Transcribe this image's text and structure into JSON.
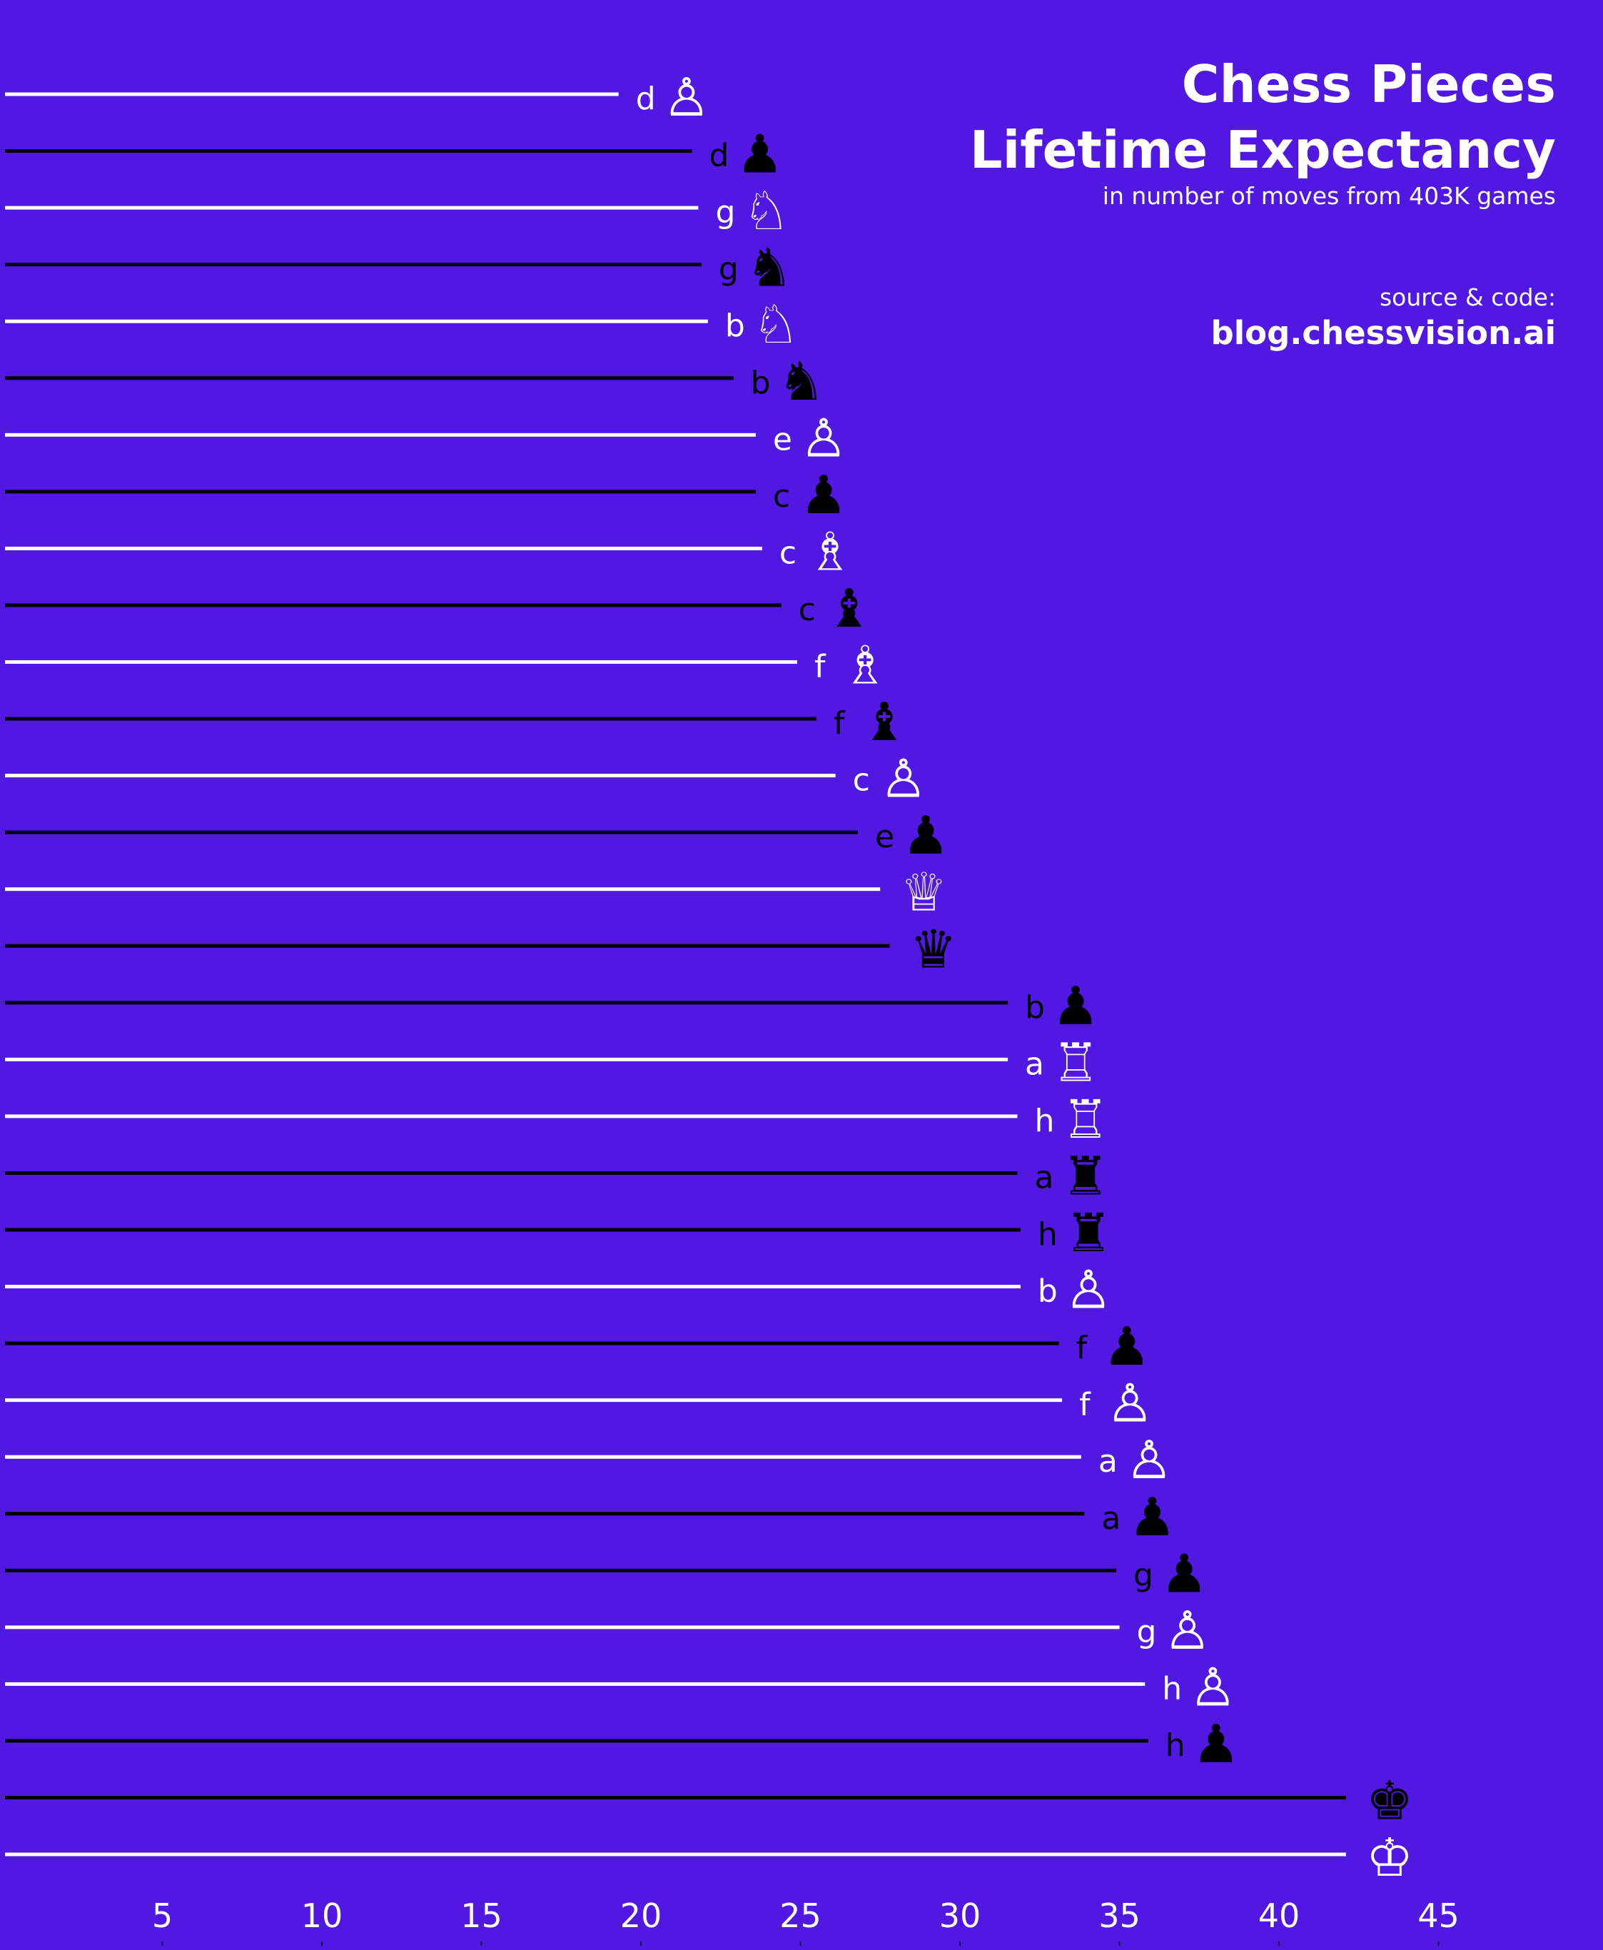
{
  "header": {
    "title_line1": "Chess Pieces",
    "title_line2": "Lifetime Expectancy",
    "subtitle": "in number of moves from 403K games",
    "source_label": "source & code:",
    "source_link": "blog.chessvision.ai"
  },
  "colors": {
    "background": "#5018e0",
    "white_piece": "#ffffff",
    "black_piece": "#000000"
  },
  "chart_data": {
    "type": "bar",
    "orientation": "horizontal",
    "title": "Chess Pieces Lifetime Expectancy",
    "subtitle": "in number of moves from 403K games",
    "xlabel": "",
    "ylabel": "",
    "xlim": [
      0,
      47
    ],
    "xticks": [
      5,
      10,
      15,
      20,
      25,
      30,
      35,
      40,
      45
    ],
    "grid": false,
    "legend": "none",
    "bars": [
      {
        "color": "white",
        "piece": "pawn",
        "file": "d",
        "value": 19.3
      },
      {
        "color": "black",
        "piece": "pawn",
        "file": "d",
        "value": 21.6
      },
      {
        "color": "white",
        "piece": "knight",
        "file": "g",
        "value": 21.8
      },
      {
        "color": "black",
        "piece": "knight",
        "file": "g",
        "value": 21.9
      },
      {
        "color": "white",
        "piece": "knight",
        "file": "b",
        "value": 22.1
      },
      {
        "color": "black",
        "piece": "knight",
        "file": "b",
        "value": 22.9
      },
      {
        "color": "white",
        "piece": "pawn",
        "file": "e",
        "value": 23.6
      },
      {
        "color": "black",
        "piece": "pawn",
        "file": "c",
        "value": 23.6
      },
      {
        "color": "white",
        "piece": "bishop",
        "file": "c",
        "value": 23.8
      },
      {
        "color": "black",
        "piece": "bishop",
        "file": "c",
        "value": 24.4
      },
      {
        "color": "white",
        "piece": "bishop",
        "file": "f",
        "value": 24.9
      },
      {
        "color": "black",
        "piece": "bishop",
        "file": "f",
        "value": 25.5
      },
      {
        "color": "white",
        "piece": "pawn",
        "file": "c",
        "value": 26.1
      },
      {
        "color": "black",
        "piece": "pawn",
        "file": "e",
        "value": 26.8
      },
      {
        "color": "white",
        "piece": "queen",
        "file": "",
        "value": 27.5
      },
      {
        "color": "black",
        "piece": "queen",
        "file": "",
        "value": 27.8
      },
      {
        "color": "black",
        "piece": "pawn",
        "file": "b",
        "value": 31.5
      },
      {
        "color": "white",
        "piece": "rook",
        "file": "a",
        "value": 31.5
      },
      {
        "color": "white",
        "piece": "rook",
        "file": "h",
        "value": 31.8
      },
      {
        "color": "black",
        "piece": "rook",
        "file": "a",
        "value": 31.8
      },
      {
        "color": "black",
        "piece": "rook",
        "file": "h",
        "value": 31.9
      },
      {
        "color": "white",
        "piece": "pawn",
        "file": "b",
        "value": 31.9
      },
      {
        "color": "black",
        "piece": "pawn",
        "file": "f",
        "value": 33.1
      },
      {
        "color": "white",
        "piece": "pawn",
        "file": "f",
        "value": 33.2
      },
      {
        "color": "white",
        "piece": "pawn",
        "file": "a",
        "value": 33.8
      },
      {
        "color": "black",
        "piece": "pawn",
        "file": "a",
        "value": 33.9
      },
      {
        "color": "black",
        "piece": "pawn",
        "file": "g",
        "value": 34.9
      },
      {
        "color": "white",
        "piece": "pawn",
        "file": "g",
        "value": 35.0
      },
      {
        "color": "white",
        "piece": "pawn",
        "file": "h",
        "value": 35.8
      },
      {
        "color": "black",
        "piece": "pawn",
        "file": "h",
        "value": 35.9
      },
      {
        "color": "black",
        "piece": "king",
        "file": "",
        "value": 42.1
      },
      {
        "color": "white",
        "piece": "king",
        "file": "",
        "value": 42.1
      }
    ]
  }
}
